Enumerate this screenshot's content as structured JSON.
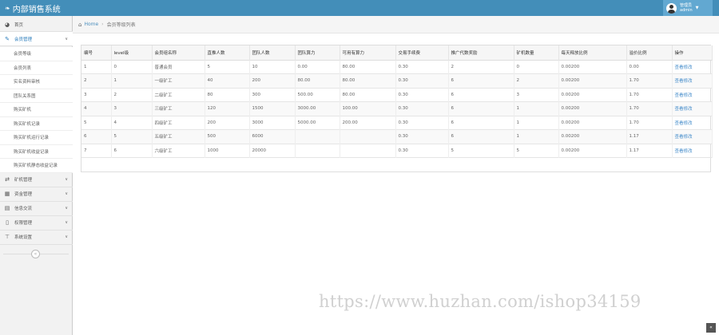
{
  "app": {
    "title": "内部销售系统"
  },
  "user": {
    "line1": "管理员",
    "line2": "admin"
  },
  "sidebar": {
    "items": [
      {
        "label": "首页",
        "icon": "tachometer-icon"
      },
      {
        "label": "会员管理",
        "icon": "edit-icon"
      },
      {
        "label": "矿机管理",
        "icon": "shuffle-icon"
      },
      {
        "label": "资金管理",
        "icon": "calendar-icon"
      },
      {
        "label": "信息交流",
        "icon": "list-alt-icon"
      },
      {
        "label": "权限管理",
        "icon": "file-icon"
      },
      {
        "label": "系统设置",
        "icon": "settings-icon"
      }
    ],
    "sub_items": [
      "会员等级",
      "会员列表",
      "实名资料审核",
      "团队关系图",
      "购买矿机",
      "购买矿机记录",
      "购买矿机运行记录",
      "购买矿机收益记录",
      "购买矿机静态收益记录"
    ],
    "toggle": "«"
  },
  "breadcrumb": {
    "home": "Home",
    "current": "会员等级列表"
  },
  "table": {
    "headers": [
      "编号",
      "level级",
      "会员组名称",
      "直推人数",
      "团队人数",
      "团队算力",
      "可用有算力",
      "交易手续费",
      "推广代数奖励",
      "矿机数量",
      "每天释放比例",
      "溢价比例",
      "操作"
    ],
    "rows": [
      [
        "1",
        "0",
        "普通会员",
        "5",
        "10",
        "0.00",
        "80.00",
        "0.30",
        "2",
        "0",
        "0.00200",
        "0.00",
        "查看修改"
      ],
      [
        "2",
        "1",
        "一级矿工",
        "40",
        "200",
        "80.00",
        "80.00",
        "0.30",
        "6",
        "2",
        "0.00200",
        "1.70",
        "查看修改"
      ],
      [
        "3",
        "2",
        "二级矿工",
        "80",
        "300",
        "500.00",
        "80.00",
        "0.30",
        "6",
        "3",
        "0.00200",
        "1.70",
        "查看修改"
      ],
      [
        "4",
        "3",
        "三级矿工",
        "120",
        "1500",
        "3000.00",
        "100.00",
        "0.30",
        "6",
        "1",
        "0.00200",
        "1.70",
        "查看修改"
      ],
      [
        "5",
        "4",
        "四级矿工",
        "200",
        "3000",
        "5000.00",
        "200.00",
        "0.30",
        "6",
        "1",
        "0.00200",
        "1.70",
        "查看修改"
      ],
      [
        "6",
        "5",
        "五级矿工",
        "500",
        "6000",
        "",
        "",
        "0.30",
        "6",
        "1",
        "0.00200",
        "1.17",
        "查看修改"
      ],
      [
        "7",
        "6",
        "六级矿工",
        "1000",
        "20000",
        "",
        "",
        "0.30",
        "5",
        "5",
        "0.00200",
        "1.17",
        "查看修改"
      ]
    ]
  },
  "watermark": "https://www.huzhan.com/ishop34159",
  "scroll_top": "«",
  "colors": {
    "header": "#438eb9",
    "user_box": "#62a8d1",
    "link": "#428bca"
  }
}
